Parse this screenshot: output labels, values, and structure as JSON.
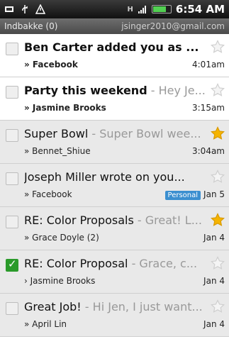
{
  "status": {
    "time": "6:54 AM",
    "battery_level": 0.7,
    "h_badge": "H"
  },
  "header": {
    "title": "Indbakke (0)",
    "account": "jsinger2010@gmail.com"
  },
  "emails": [
    {
      "subject": "Ben Carter added you as ...",
      "snippet": "",
      "from": "» Facebook",
      "date": "4:01am",
      "starred": false,
      "read": false,
      "checked": false,
      "label": ""
    },
    {
      "subject": "Party this weekend",
      "snippet": " - Hey Je...",
      "from": "» Jasmine Brooks",
      "date": "3:15am",
      "starred": false,
      "read": false,
      "checked": false,
      "label": ""
    },
    {
      "subject": "Super Bowl",
      "snippet": " - Super Bowl wee...",
      "from": "» Bennet_Shiue",
      "date": "3:04am",
      "starred": true,
      "read": true,
      "checked": false,
      "label": ""
    },
    {
      "subject": "Joseph Miller wrote on you...",
      "snippet": "",
      "from": "» Facebook",
      "date": "Jan 5",
      "starred": false,
      "read": true,
      "checked": false,
      "label": "Personal"
    },
    {
      "subject": "RE: Color Proposals",
      "snippet": " - Great! L...",
      "from": "» Grace Doyle (2)",
      "date": "Jan 4",
      "starred": true,
      "read": true,
      "checked": false,
      "label": ""
    },
    {
      "subject": "RE: Color Proposal",
      "snippet": " - Grace, c...",
      "from": "› Jasmine Brooks",
      "date": "Jan 4",
      "starred": false,
      "read": true,
      "checked": true,
      "label": ""
    },
    {
      "subject": "Great Job!",
      "snippet": " - Hi Jen, I just want...",
      "from": "» April Lin",
      "date": "Jan 4",
      "starred": false,
      "read": true,
      "checked": false,
      "label": ""
    }
  ],
  "colors": {
    "star_on": "#f5b400",
    "star_off": "#cfcfcf",
    "label_bg": "#3b8fd0",
    "check_bg": "#2a9a2a"
  }
}
